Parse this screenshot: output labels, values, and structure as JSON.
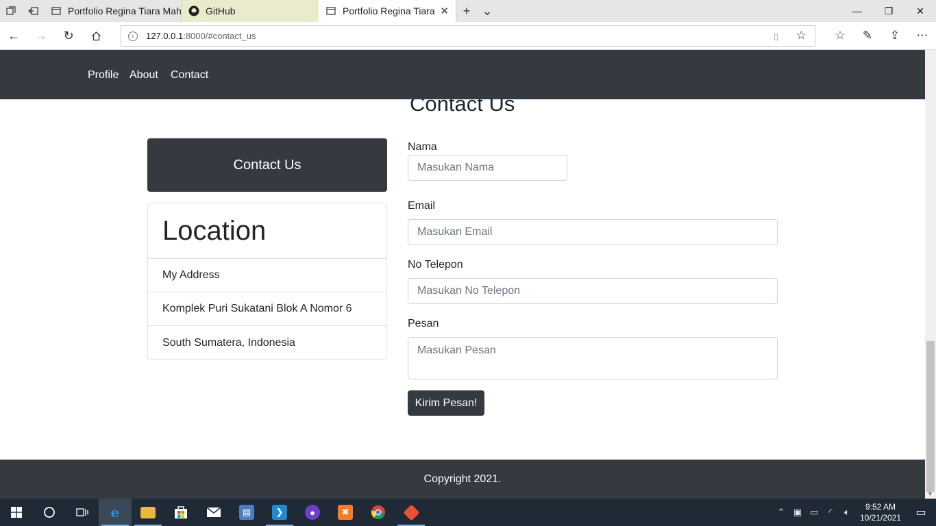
{
  "browser": {
    "tabs": [
      {
        "title": "Portfolio Regina Tiara Maha",
        "icon": "page-icon"
      },
      {
        "title": "GitHub",
        "icon": "github-icon"
      },
      {
        "title": "Portfolio Regina Tiara M",
        "icon": "page-icon"
      }
    ],
    "url_host": "127.0.0.1",
    "url_path": ":8000/#contact_us"
  },
  "page": {
    "nav": {
      "profile": "Profile",
      "about": "About",
      "contact": "Contact"
    },
    "section_title": "Contact Us",
    "contact_card": "Contact Us",
    "location": {
      "heading": "Location",
      "items": [
        "My Address",
        "Komplek Puri Sukatani Blok A Nomor 6",
        "South Sumatera, Indonesia"
      ]
    },
    "form": {
      "nama_label": "Nama",
      "nama_placeholder": "Masukan Nama",
      "email_label": "Email",
      "email_placeholder": "Masukan Email",
      "telepon_label": "No Telepon",
      "telepon_placeholder": "Masukan No Telepon",
      "pesan_label": "Pesan",
      "pesan_placeholder": "Masukan Pesan",
      "submit": "Kirim Pesan!"
    },
    "footer": "Copyright 2021."
  },
  "taskbar": {
    "time": "9:52 AM",
    "date": "10/21/2021"
  },
  "colors": {
    "navbar": "#343a40",
    "taskbar": "#1f2a36"
  }
}
